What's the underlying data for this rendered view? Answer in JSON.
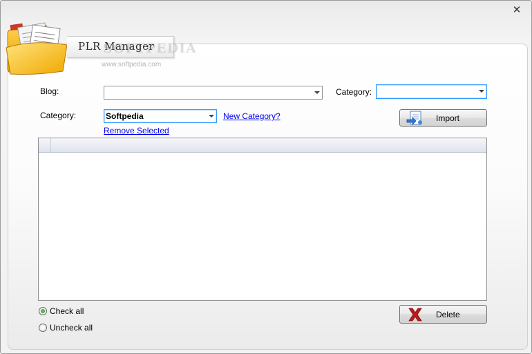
{
  "window": {
    "title": "PLR Manager",
    "watermark": "SOFTPEDIA",
    "url": "www.softpedia.com"
  },
  "form": {
    "blog_label": "Blog:",
    "blog_value": "",
    "category_top_label": "Category:",
    "category_top_value": "",
    "category_label": "Category:",
    "category_value": "Softpedia",
    "new_category_link": "New Category?",
    "remove_selected_link": "Remove Selected"
  },
  "buttons": {
    "import_label": "Import",
    "delete_label": "Delete"
  },
  "options": {
    "check_all": "Check all",
    "uncheck_all": "Uncheck all",
    "selected": "check_all"
  },
  "icons": {
    "close": "close-icon",
    "logo": "folder-documents-icon",
    "import": "import-document-icon",
    "delete": "red-x-icon"
  },
  "colors": {
    "link": "#0000ee",
    "focus": "#3399ff",
    "delete_red": "#c21a1a",
    "radio_green": "#178a17"
  }
}
